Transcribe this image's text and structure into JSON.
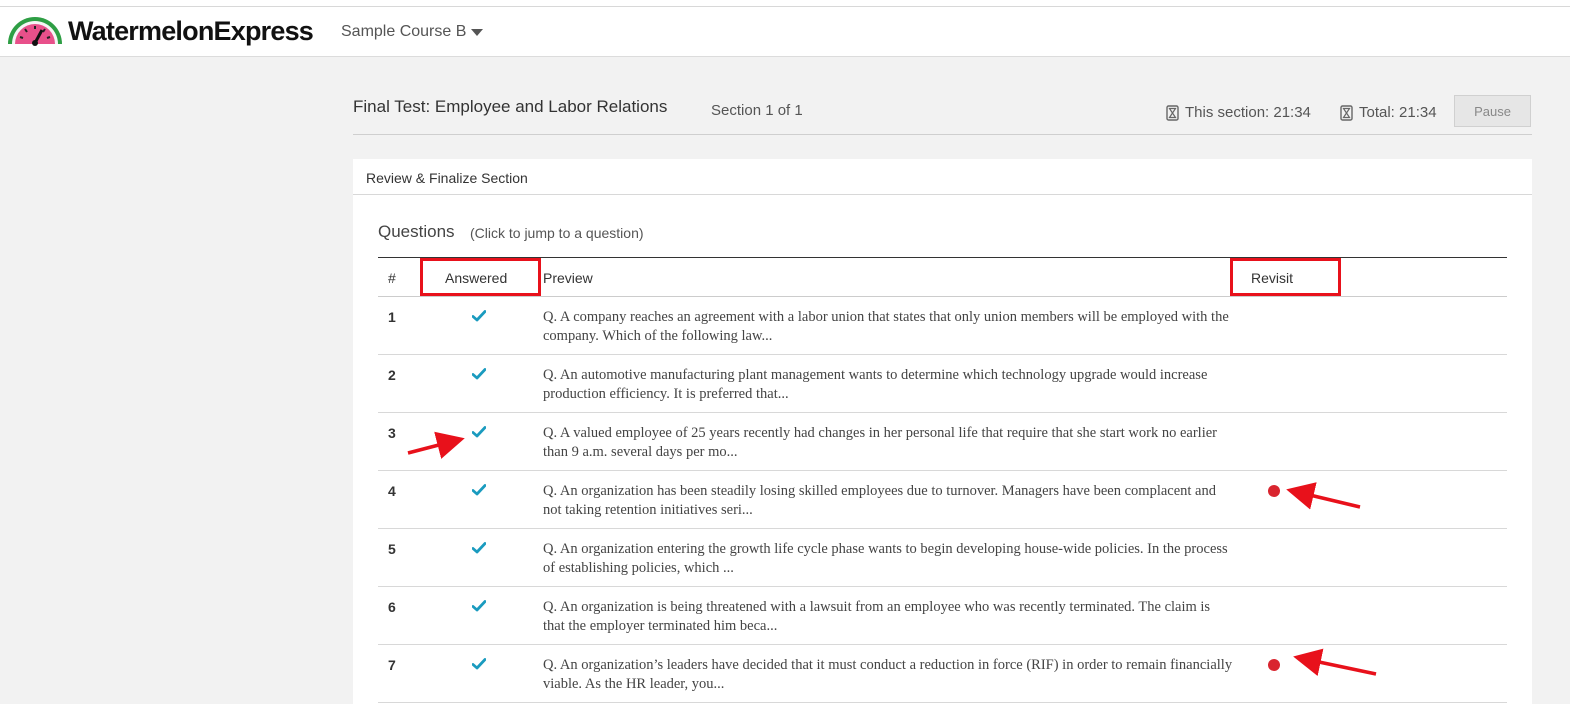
{
  "app": {
    "logo_text": "WatermelonExpress"
  },
  "header": {
    "course_select": "Sample Course B"
  },
  "test": {
    "title": "Final Test: Employee and Labor Relations",
    "section_counter": "Section 1 of 1",
    "timer_section": "This section: 21:34",
    "timer_total": "Total: 21:34",
    "pause_label": "Pause"
  },
  "review": {
    "panel_title": "Review & Finalize Section",
    "questions_heading": "Questions",
    "questions_hint": "(Click to jump to a question)",
    "columns": [
      "#",
      "Answered",
      "Preview",
      "Revisit"
    ],
    "rows": [
      {
        "num": "1",
        "answered": true,
        "revisit": false,
        "preview": "Q. A company reaches an agreement with a labor union that states that only union members will be employed with the company. Which of the following law..."
      },
      {
        "num": "2",
        "answered": true,
        "revisit": false,
        "preview": "Q. An automotive manufacturing plant management wants to determine which technology upgrade would increase production efficiency. It is preferred that..."
      },
      {
        "num": "3",
        "answered": true,
        "revisit": false,
        "preview": "Q. A valued employee of 25 years recently had changes in her personal life that require that she start work no earlier than 9 a.m. several days per mo..."
      },
      {
        "num": "4",
        "answered": true,
        "revisit": true,
        "preview": "Q. An organization has been steadily losing skilled employees due to turnover. Managers have been complacent and not taking retention initiatives seri..."
      },
      {
        "num": "5",
        "answered": true,
        "revisit": false,
        "preview": "Q. An organization entering the growth life cycle phase wants to begin developing house-wide policies. In the process of establishing policies, which ..."
      },
      {
        "num": "6",
        "answered": true,
        "revisit": false,
        "preview": "Q. An organization is being threatened with a lawsuit from an employee who was recently terminated. The claim is that the employer terminated him beca..."
      },
      {
        "num": "7",
        "answered": true,
        "revisit": true,
        "preview": "Q. An organization’s leaders have decided that it must conduct a reduction in force (RIF) in order to remain financially viable. As the HR leader, you..."
      }
    ]
  },
  "colors": {
    "check": "#1a9bbf",
    "revisit_dot": "#d9252f",
    "annotation": "#e8111b"
  },
  "icons": {
    "check": "checkmark-icon",
    "timer": "hourglass-icon",
    "caret": "caret-down-icon"
  }
}
